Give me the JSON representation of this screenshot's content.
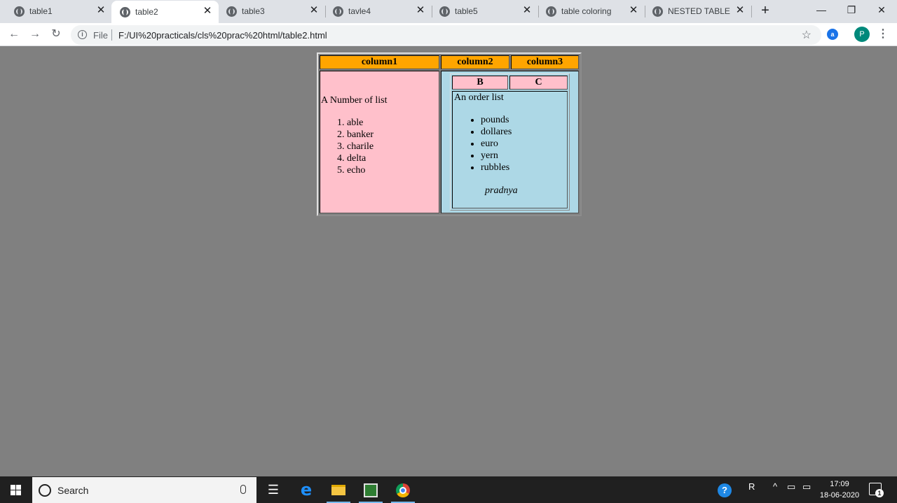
{
  "browser": {
    "tabs": [
      {
        "title": "table1",
        "active": false
      },
      {
        "title": "table2",
        "active": true
      },
      {
        "title": "table3",
        "active": false
      },
      {
        "title": "tavle4",
        "active": false
      },
      {
        "title": "table5",
        "active": false
      },
      {
        "title": "table coloring",
        "active": false
      },
      {
        "title": "NESTED TABLE",
        "active": false
      }
    ],
    "tab_icon": "globe-icon",
    "close_glyph": "✕",
    "new_tab_glyph": "+",
    "window_controls": {
      "minimize": "—",
      "restore": "❐",
      "close": "✕"
    },
    "nav": {
      "back": "←",
      "forward": "→",
      "reload": "↻"
    },
    "address": {
      "scheme_label": "File",
      "info_glyph": "i",
      "url": "F:/UI%20practicals/cls%20prac%20html/table2.html",
      "star_glyph": "☆"
    },
    "extension_glyph": "a",
    "profile_initial": "P",
    "menu_glyph": "⋮"
  },
  "page": {
    "background": "#808080",
    "header_color": "#ffa500",
    "pink_color": "#ffc0cb",
    "blue_color": "#add8e6",
    "outer_table": {
      "headers": [
        "column1",
        "column2",
        "column3"
      ],
      "left_cell": {
        "heading": "A Number of list",
        "ordered_items": [
          "able",
          "banker",
          "charile",
          "delta",
          "echo"
        ]
      },
      "inner_table": {
        "headers": [
          "B",
          "C"
        ],
        "body_heading": "An order list",
        "unordered_items": [
          "pounds",
          "dollares",
          "euro",
          "yern",
          "rubbles"
        ],
        "signature": "pradnya"
      }
    }
  },
  "taskbar": {
    "search_placeholder": "Search",
    "apps": [
      "task-view-icon",
      "edge-icon",
      "file-explorer-icon",
      "spreadsheet-icon",
      "chrome-icon"
    ],
    "tray": {
      "help_glyph": "?",
      "people_glyph": "R",
      "chevron_glyph": "^",
      "network_glyph": "▭",
      "battery_glyph": "▭"
    },
    "time": "17:09",
    "date": "18-06-2020",
    "notification_count": "1"
  }
}
